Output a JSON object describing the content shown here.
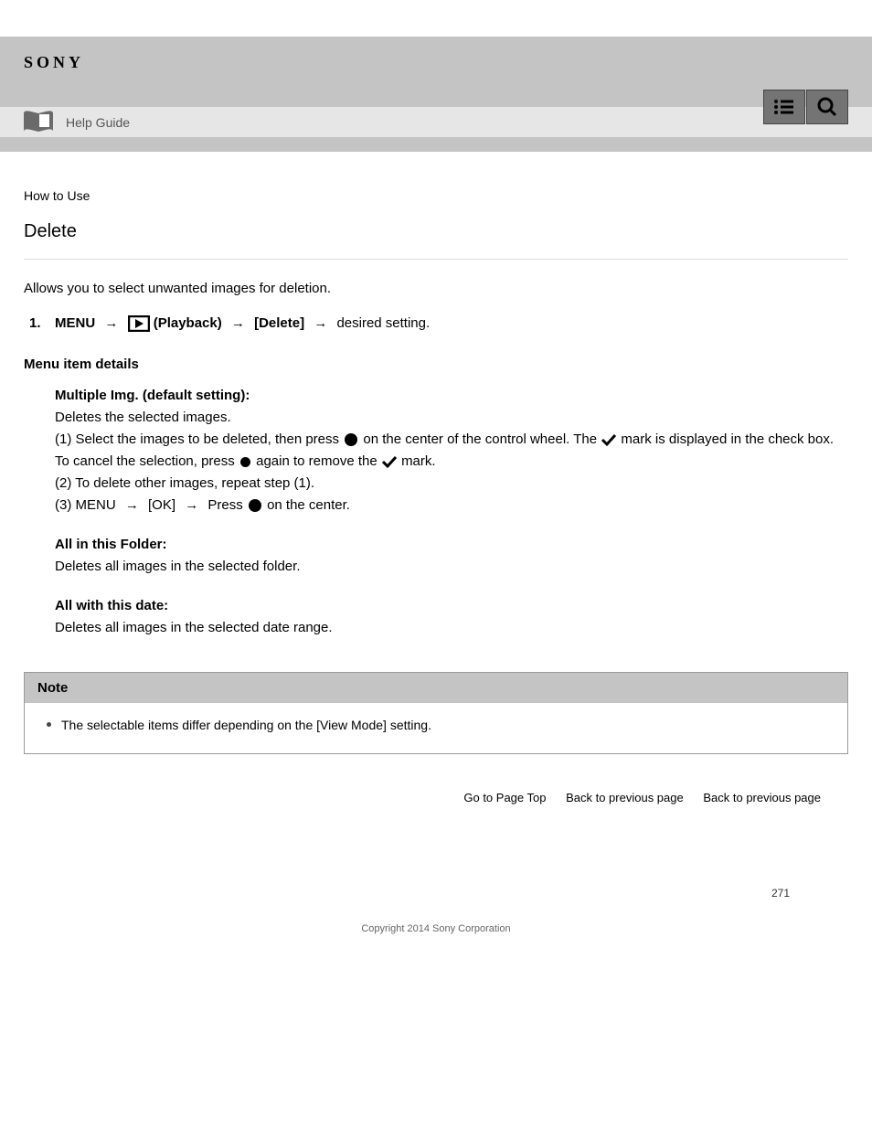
{
  "header": {
    "brand": "SONY",
    "menu_aria": "menu",
    "search_aria": "search"
  },
  "subheader": {
    "guide_label": "Help Guide"
  },
  "breadcrumb": "How to Use",
  "page_title": "Delete",
  "intro": "Allows you to select unwanted images for deletion.",
  "step1": {
    "lead": "MENU",
    "playback_label": "Playback",
    "delete_label": "[Delete]",
    "tail": "desired setting."
  },
  "menu_heading": "Menu item details",
  "options": {
    "multi": {
      "term": "Multiple Img. (default setting):",
      "desc_before": "Deletes the selected images.",
      "desc_line2_a": "(1) Select the images to be deleted, then press",
      "desc_line2_b": "on the center of the control wheel. The",
      "desc_line2_c": "mark is displayed in the check box. To cancel the selection, press",
      "desc_line2_d": "again to remove the",
      "desc_line2_e": "mark.",
      "desc_line3": "(2) To delete other images, repeat step (1).",
      "desc_line4_a": "(3) MENU",
      "desc_line4_ok": "[OK]",
      "desc_line4_press": "Press",
      "desc_line4_b": "on the center."
    },
    "all": {
      "term": "All in this Folder:",
      "desc": "Deletes all images in the selected folder."
    },
    "date": {
      "term": "All with this date:",
      "desc": "Deletes all images in the selected date range."
    }
  },
  "note": {
    "heading": "Note",
    "item": "The selectable items differ depending on the [View Mode] setting."
  },
  "footer": {
    "top": "Go to Page Top",
    "back": "Back to previous page",
    "back2": "Back to previous page"
  },
  "page_number": "271",
  "copyright": "Copyright 2014 Sony Corporation"
}
